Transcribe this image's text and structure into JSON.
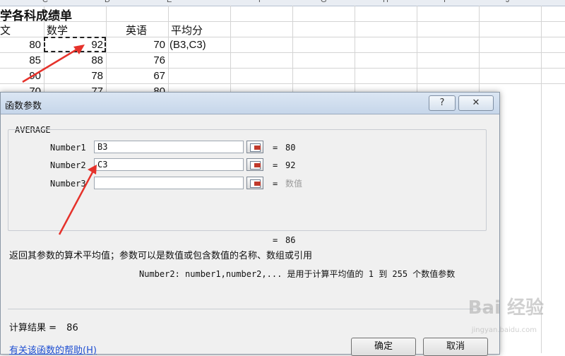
{
  "spreadsheet": {
    "column_headers": [
      "C",
      "D",
      "E",
      "F",
      "G",
      "H",
      "I",
      "J"
    ],
    "title": "学各科成绩单",
    "headers": [
      "文",
      "数学",
      "英语",
      "平均分"
    ],
    "rows": [
      {
        "c0": "80",
        "c1": "92",
        "c2": "70",
        "c3": "(B3,C3)"
      },
      {
        "c0": "85",
        "c1": "88",
        "c2": "76",
        "c3": ""
      },
      {
        "c0": "90",
        "c1": "78",
        "c2": "67",
        "c3": ""
      },
      {
        "c0": "70",
        "c1": "77",
        "c2": "80",
        "c3": ""
      }
    ]
  },
  "dialog": {
    "title": "函数参数",
    "help_button": "?",
    "function_name": "AVERAGE",
    "args": [
      {
        "label": "Number1",
        "value": "B3",
        "result": "80"
      },
      {
        "label": "Number2",
        "value": "C3",
        "result": "92"
      },
      {
        "label": "Number3",
        "value": "",
        "result": "数值"
      }
    ],
    "equals": "=",
    "total_result": "86",
    "description": "返回其参数的算术平均值；参数可以是数值或包含数值的名称、数组或引用",
    "arg_help": "Number2:  number1,number2,... 是用于计算平均值的 1 到 255 个数值参数",
    "calc_result_label": "计算结果 =",
    "calc_result_value": "86",
    "help_link": "有关该函数的帮助(H)",
    "ok_button": "确定",
    "cancel_button": "取消"
  },
  "watermark": {
    "text": "Bai 经验",
    "sub": "jingyan.baidu.com"
  },
  "colors": {
    "arrow": "#e5322b",
    "link": "#1f4fd1"
  },
  "icons": {
    "range_selector": "range-select-icon",
    "close": "close-icon",
    "arrow": "red-arrow-annotation"
  }
}
